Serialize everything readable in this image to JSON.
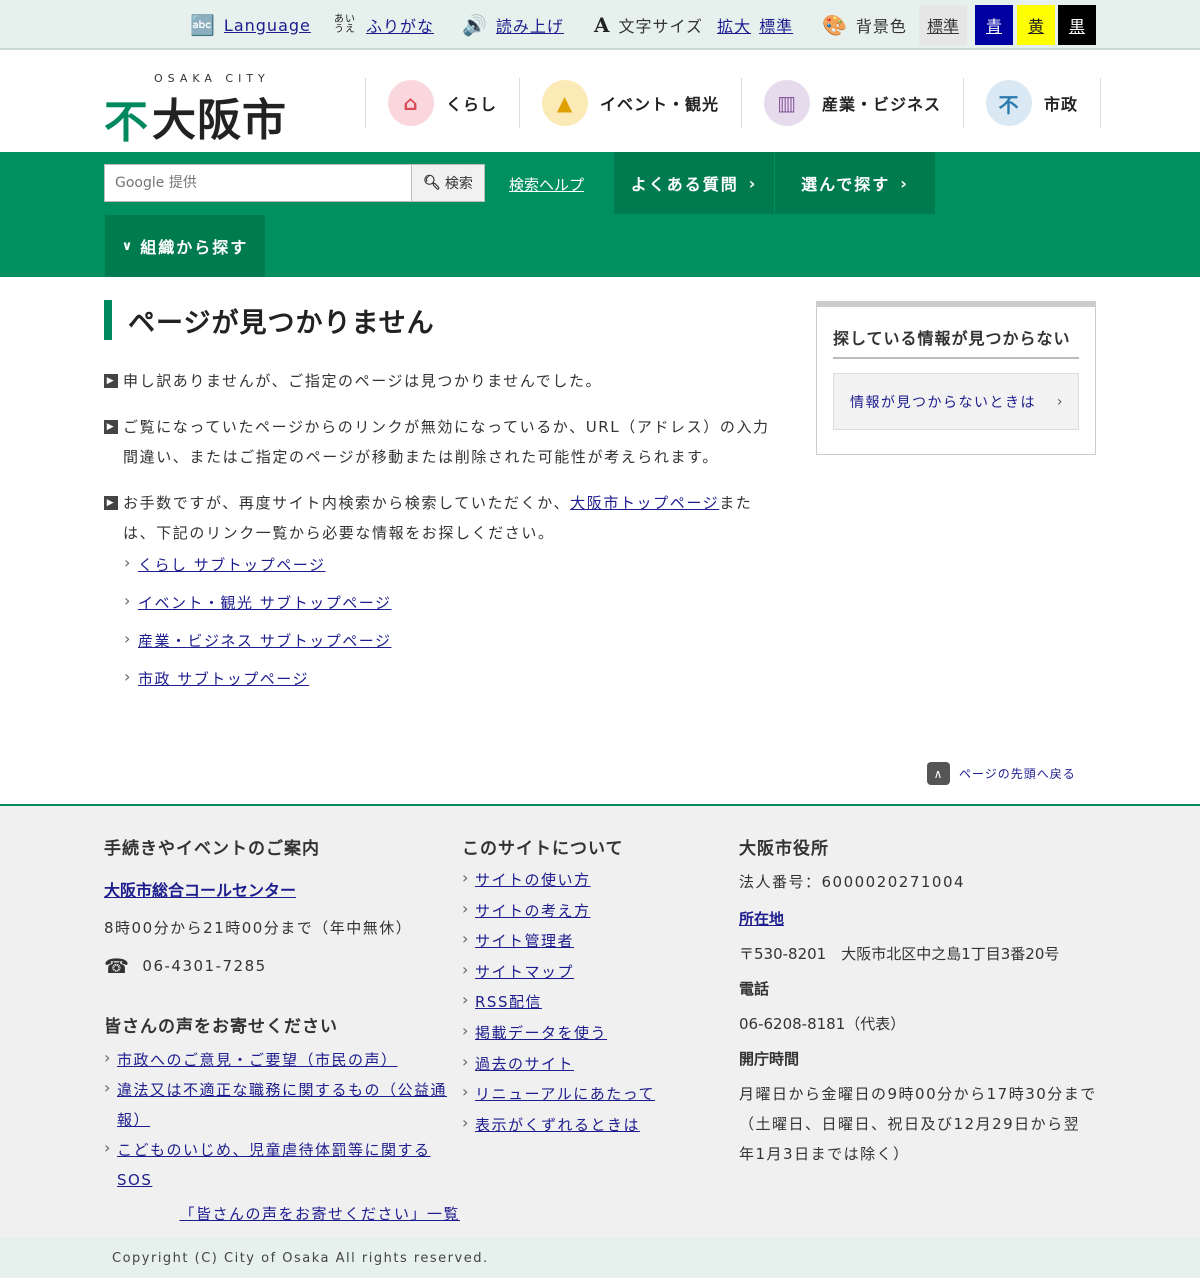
{
  "utility": {
    "language": "Language",
    "furigana": "ふりがな",
    "furigana_icon_text": "あい うえ",
    "read_aloud": "読み上げ",
    "font_size_label": "文字サイズ",
    "font_enlarge": "拡大",
    "font_standard": "標準",
    "bg_label": "背景色",
    "bg_standard": "標準",
    "bg_blue": "青",
    "bg_yellow": "黄",
    "bg_black": "黒",
    "colors": {
      "blue": "#0000a0",
      "yellow": "#ffff00",
      "black": "#000000"
    }
  },
  "header": {
    "logo_sub": "OSAKA CITY",
    "logo_text": "大阪市",
    "nav": [
      {
        "label": "くらし"
      },
      {
        "label": "イベント・観光"
      },
      {
        "label": "産業・ビジネス"
      },
      {
        "label": "市政"
      }
    ]
  },
  "search": {
    "placeholder": "Google 提供",
    "button": "検索",
    "help": "検索ヘルプ",
    "faq": "よくある質問",
    "choose": "選んで探す",
    "org": "組織から探す"
  },
  "main": {
    "title": "ページが見つかりません",
    "p1": "申し訳ありませんが、ご指定のページは見つかりませんでした。",
    "p2": "ご覧になっていたページからのリンクが無効になっているか、URL（アドレス）の入力間違い、またはご指定のページが移動または削除された可能性が考えられます。",
    "p3_before": "お手数ですが、再度サイト内検索から検索していただくか、",
    "p3_link": "大阪市トップページ",
    "p3_after": "または、下記のリンク一覧から必要な情報をお探しください。",
    "links": [
      "くらし サブトップページ",
      "イベント・観光 サブトップページ",
      "産業・ビジネス サブトップページ",
      "市政 サブトップページ"
    ]
  },
  "sidebar": {
    "title": "探している情報が見つからない",
    "button": "情報が見つからないときは"
  },
  "pagetop": "ページの先頭へ戻る",
  "footer": {
    "col1": {
      "title": "手続きやイベントのご案内",
      "callcenter": "大阪市総合コールセンター",
      "hours": "8時00分から21時00分まで（年中無休）",
      "phone": "06-4301-7285",
      "voice_title": "皆さんの声をお寄せください",
      "voice_links": [
        "市政へのご意見・ご要望（市民の声）",
        "違法又は不適正な職務に関するもの（公益通報）",
        "こどものいじめ、児童虐待体罰等に関するSOS"
      ],
      "voice_list": "「皆さんの声をお寄せください」一覧"
    },
    "col2": {
      "title": "このサイトについて",
      "links": [
        "サイトの使い方",
        "サイトの考え方",
        "サイト管理者",
        "サイトマップ",
        "RSS配信",
        "掲載データを使う",
        "過去のサイト",
        "リニューアルにあたって",
        "表示がくずれるときは"
      ]
    },
    "col3": {
      "title": "大阪市役所",
      "corp_number": "法人番号：6000020271004",
      "location_label": "所在地",
      "address": "〒530-8201　大阪市北区中之島1丁目3番20号",
      "tel_label": "電話",
      "tel": "06-6208-8181（代表）",
      "hours_label": "開庁時間",
      "hours": "月曜日から金曜日の9時00分から17時30分まで",
      "hours_note": "（土曜日、日曜日、祝日及び12月29日から翌年1月3日までは除く）"
    }
  },
  "copyright": "Copyright (C) City of Osaka All rights reserved."
}
